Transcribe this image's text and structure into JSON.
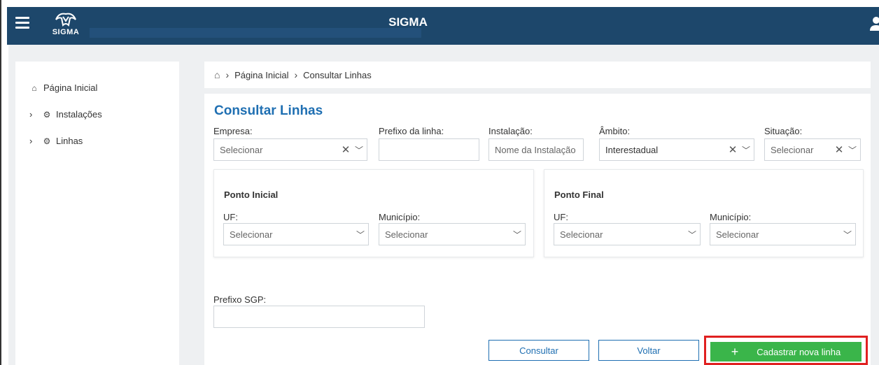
{
  "app": {
    "title": "SIGMA",
    "logo_text": "SIGMA"
  },
  "sidebar": {
    "items": [
      {
        "label": "Página Inicial",
        "icon": "home-icon"
      },
      {
        "label": "Instalações",
        "icon": "gear-icon"
      },
      {
        "label": "Linhas",
        "icon": "gear-icon"
      }
    ]
  },
  "breadcrumb": {
    "items": [
      "Página Inicial",
      "Consultar Linhas"
    ]
  },
  "page": {
    "title": "Consultar Linhas"
  },
  "filters": {
    "empresa": {
      "label": "Empresa:",
      "placeholder": "Selecionar"
    },
    "prefixo": {
      "label": "Prefixo da linha:",
      "value": ""
    },
    "instalacao": {
      "label": "Instalação:",
      "placeholder": "Nome da Instalação"
    },
    "ambito": {
      "label": "Âmbito:",
      "value": "Interestadual"
    },
    "situacao": {
      "label": "Situação:",
      "placeholder": "Selecionar"
    }
  },
  "ponto_inicial": {
    "title": "Ponto Inicial",
    "uf": {
      "label": "UF:",
      "placeholder": "Selecionar"
    },
    "municipio": {
      "label": "Município:",
      "placeholder": "Selecionar"
    }
  },
  "ponto_final": {
    "title": "Ponto Final",
    "uf": {
      "label": "UF:",
      "placeholder": "Selecionar"
    },
    "municipio": {
      "label": "Município:",
      "placeholder": "Selecionar"
    }
  },
  "prefixo_sgp": {
    "label": "Prefixo SGP:",
    "value": ""
  },
  "actions": {
    "consultar": "Consultar",
    "voltar": "Voltar",
    "cadastrar": "Cadastrar nova linha",
    "cadastrar_icon": "+"
  },
  "colors": {
    "header": "#1d476b",
    "title": "#1f6fb2",
    "primary_button": "#3ab54a",
    "highlight": "#e02020"
  }
}
